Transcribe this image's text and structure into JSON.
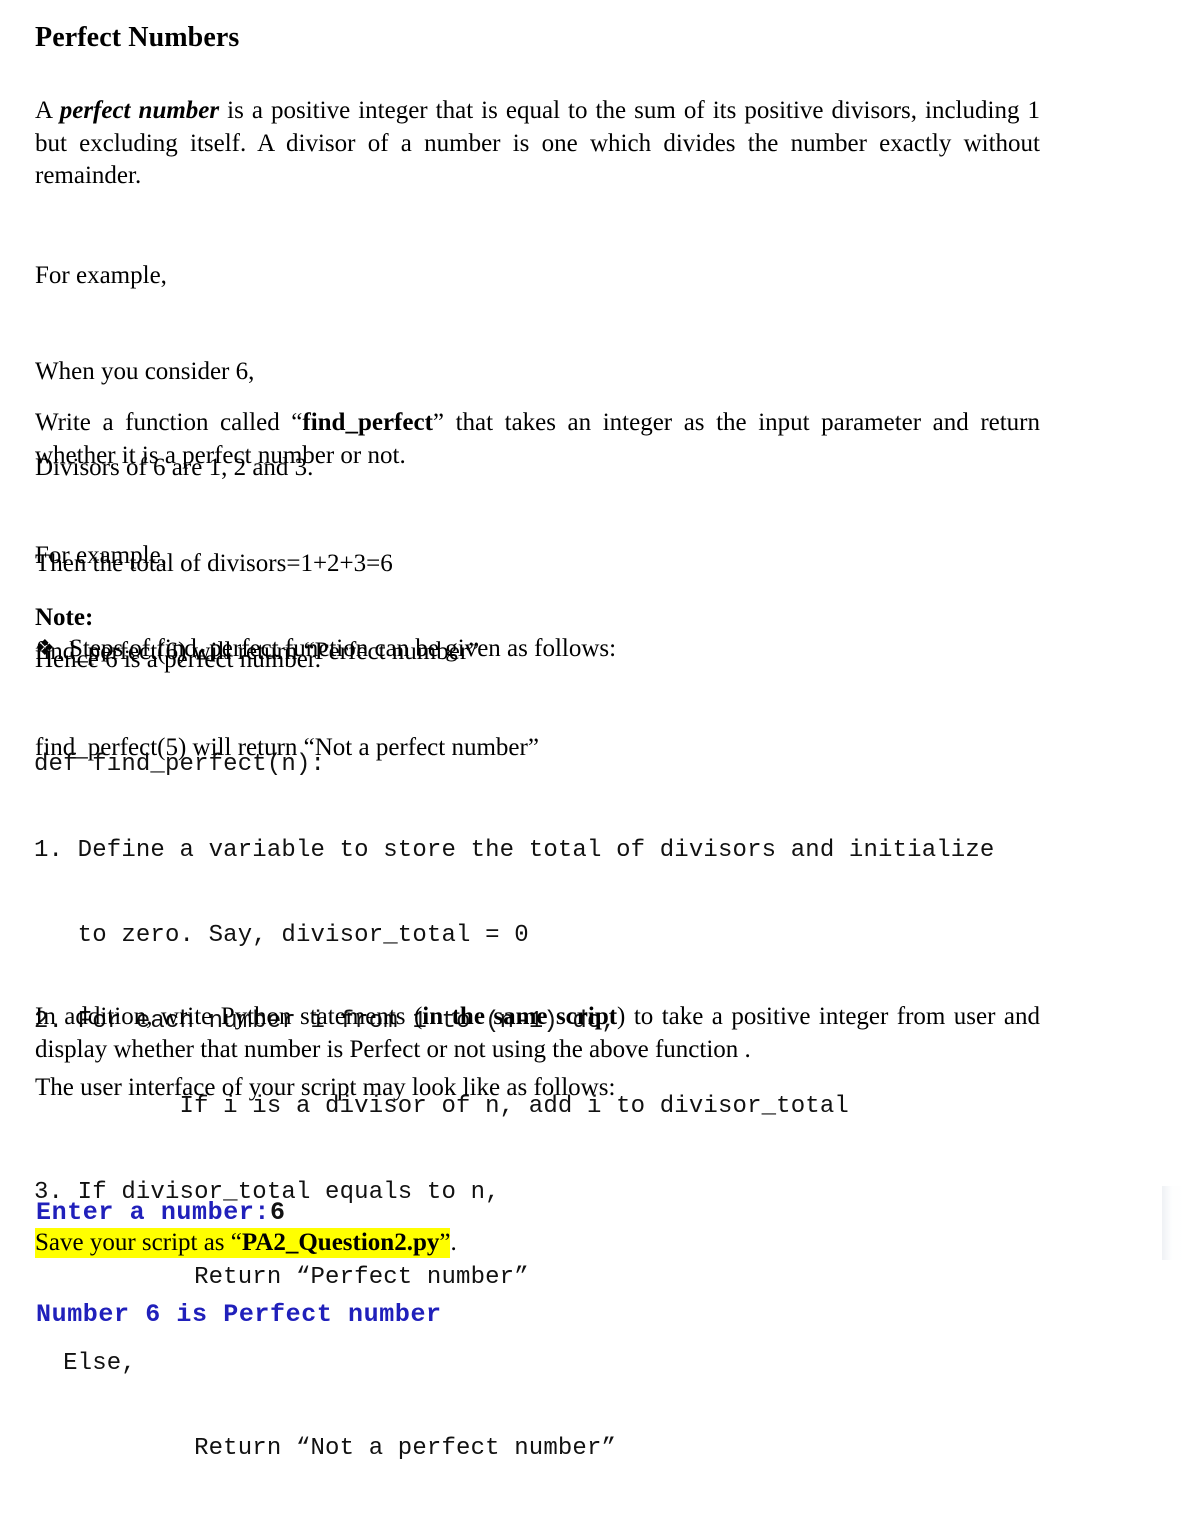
{
  "document": {
    "title": "Perfect Numbers",
    "definition": {
      "lead": "A ",
      "term": "perfect number",
      "rest": " is a positive integer that is equal to the sum of its positive divisors, including 1 but excluding itself. A divisor of a number is one which divides the number exactly without remainder."
    },
    "example_block_1": [
      "For example,",
      "When you consider 6,",
      "Divisors of 6 are 1, 2 and 3.",
      "Then the total of divisors=1+2+3=6",
      "Hence 6 is a perfect number."
    ],
    "task": {
      "before": "Write a function called “",
      "function_name": "find_perfect",
      "after": "” that takes an integer as the input parameter and return whether it is a perfect number or not."
    },
    "example_block_2": [
      "For example,",
      "find_perfect(6) will return “Perfect number”",
      "find_perfect(5) will return “Not a perfect number”"
    ],
    "note": {
      "heading": "Note:",
      "bullet_glyph": "❖",
      "bullet_icon_name": "diamond-bullet-icon",
      "bullet_text": "Steps of find_perfect function can be given as follows:"
    },
    "pseudocode": [
      "def find_perfect(n):",
      "1. Define a variable to store the total of divisors and initialize",
      "   to zero. Say, divisor_total = 0",
      "2. For each number i from 1 to (n-1) do,",
      "          If i is a divisor of n, add i to divisor_total",
      "3. If divisor_total equals to n,",
      "           Return “Perfect number”",
      "  Else,",
      "           Return “Not a perfect number”"
    ],
    "addition": {
      "before": "In addition, write Python statements (",
      "emphasis": "in the same script",
      "after": ") to take a positive integer from user and display whether that number is Perfect or not using the above function ."
    },
    "ui_intro": "The user interface of your script may look like as follows:",
    "console": {
      "prompt_line_label": "Enter a number:",
      "prompt_line_input": "6",
      "result_line": "Number 6 is Perfect number",
      "prompt_color": "#2020bb",
      "input_color": "#111111"
    },
    "save_instruction": {
      "before": "Save your script as “",
      "filename": "PA2_Question2.py",
      "after": "”",
      "trailing": ".",
      "highlight_color": "#ffff00"
    }
  }
}
